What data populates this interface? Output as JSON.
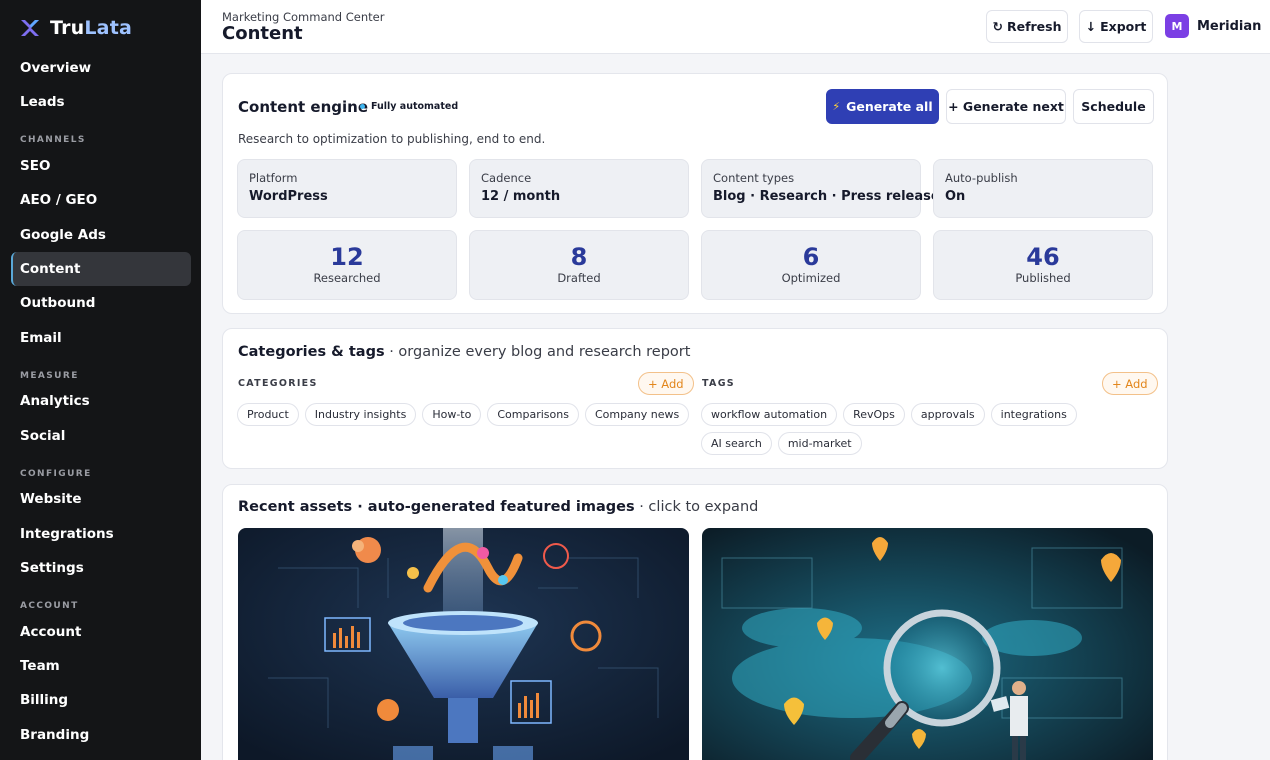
{
  "brand": {
    "name_part1": "Tru",
    "name_part2": "Lata"
  },
  "sidebar": {
    "items_top": [
      {
        "label": "Overview"
      },
      {
        "label": "Leads"
      }
    ],
    "sections": [
      {
        "title": "CHANNELS",
        "items": [
          {
            "label": "SEO"
          },
          {
            "label": "AEO / GEO"
          },
          {
            "label": "Google Ads"
          },
          {
            "label": "Content",
            "active": true
          },
          {
            "label": "Outbound"
          },
          {
            "label": "Email"
          }
        ]
      },
      {
        "title": "MEASURE",
        "items": [
          {
            "label": "Analytics"
          },
          {
            "label": "Social"
          }
        ]
      },
      {
        "title": "CONFIGURE",
        "items": [
          {
            "label": "Website"
          },
          {
            "label": "Integrations"
          },
          {
            "label": "Settings"
          }
        ]
      },
      {
        "title": "ACCOUNT",
        "items": [
          {
            "label": "Account"
          },
          {
            "label": "Team"
          },
          {
            "label": "Billing"
          },
          {
            "label": "Branding"
          }
        ]
      }
    ]
  },
  "header": {
    "breadcrumb": "Marketing Command Center",
    "title": "Content",
    "refresh_label": "Refresh",
    "export_label": "Export",
    "workspace_initial": "M",
    "workspace_name": "Meridian"
  },
  "engine": {
    "title": "Content engine",
    "badge": "Fully automated",
    "subtitle": "Research to optimization to publishing, end to end.",
    "generate_all_label": "Generate all",
    "generate_next_label": "+ Generate next",
    "schedule_label": "Schedule",
    "info": [
      {
        "label": "Platform",
        "value": "WordPress"
      },
      {
        "label": "Cadence",
        "value": "12 / month"
      },
      {
        "label": "Content types",
        "value": "Blog · Research · Press release"
      },
      {
        "label": "Auto-publish",
        "value": "On"
      }
    ],
    "stats": [
      {
        "value": "12",
        "label": "Researched"
      },
      {
        "value": "8",
        "label": "Drafted"
      },
      {
        "value": "6",
        "label": "Optimized"
      },
      {
        "value": "46",
        "label": "Published"
      }
    ]
  },
  "taxonomy": {
    "title": "Categories & tags",
    "subtitle": " · organize every blog and research report",
    "categories_label": "CATEGORIES",
    "tags_label": "TAGS",
    "add_label": "+ Add",
    "categories": [
      "Product",
      "Industry insights",
      "How-to",
      "Comparisons",
      "Company news"
    ],
    "tags": [
      "workflow automation",
      "RevOps",
      "approvals",
      "integrations",
      "AI search",
      "mid-market"
    ]
  },
  "assets": {
    "title": "Recent assets · auto-generated featured images",
    "subtitle": " · click to expand",
    "images": [
      {
        "icon": "marketing-funnel-illustration"
      },
      {
        "icon": "magnifier-map-illustration"
      }
    ]
  },
  "colors": {
    "primary": "#2f3fb4",
    "sidebar_bg": "#141517",
    "accent_orange": "#e2861c",
    "stat_number": "#2a3a9a"
  }
}
